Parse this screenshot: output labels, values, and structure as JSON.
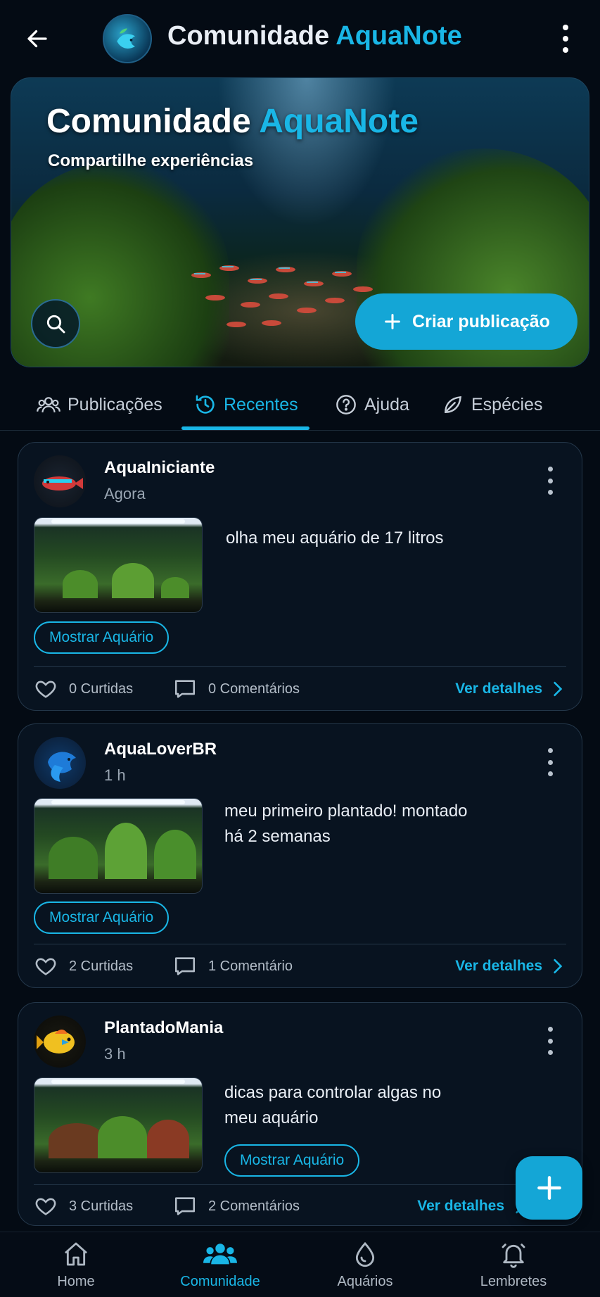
{
  "header": {
    "title_part1": "Comunidade",
    "title_part2": "AquaNote",
    "back_icon": "arrow-left-icon",
    "menu_icon": "more-vertical-icon"
  },
  "hero": {
    "title_part1": "Comunidade",
    "title_part2": "AquaNote",
    "subtitle": "Compartilhe experiências",
    "search_icon": "search-icon",
    "create_label": "Criar publicação"
  },
  "tabs": [
    {
      "label": "Publicações",
      "icon": "users-icon",
      "active": false
    },
    {
      "label": "Recentes",
      "icon": "history-icon",
      "active": true
    },
    {
      "label": "Ajuda",
      "icon": "help-circle-icon",
      "active": false
    },
    {
      "label": "Espécies",
      "icon": "leaf-icon",
      "active": false
    }
  ],
  "posts": [
    {
      "user": "AquaIniciante",
      "time": "Agora",
      "text": "olha meu aquário de 17 litros",
      "show_label": "Mostrar Aquário",
      "likes": "0 Curtidas",
      "comments": "0 Comentários",
      "details": "Ver detalhes"
    },
    {
      "user": "AquaLoverBR",
      "time": "1 h",
      "text_line1": "meu primeiro plantado! montado",
      "text_line2": "há 2 semanas",
      "show_label": "Mostrar Aquário",
      "likes": "2 Curtidas",
      "comments": "1 Comentário",
      "details": "Ver detalhes"
    },
    {
      "user": "PlantadoMania",
      "time": "3 h",
      "text_line1": "dicas para controlar algas no",
      "text_line2": "meu aquário",
      "show_label": "Mostrar Aquário",
      "likes": "3 Curtidas",
      "comments": "2 Comentários",
      "details": "Ver detalhes"
    }
  ],
  "fab": {
    "icon": "plus-icon"
  },
  "bottom_nav": [
    {
      "label": "Home",
      "icon": "home-icon",
      "active": false
    },
    {
      "label": "Comunidade",
      "icon": "community-icon",
      "active": true
    },
    {
      "label": "Aquários",
      "icon": "water-drop-icon",
      "active": false
    },
    {
      "label": "Lembretes",
      "icon": "bell-icon",
      "active": false
    }
  ],
  "colors": {
    "accent": "#19b6e6",
    "background": "#040b14",
    "card": "#081320",
    "border": "#24374a"
  }
}
